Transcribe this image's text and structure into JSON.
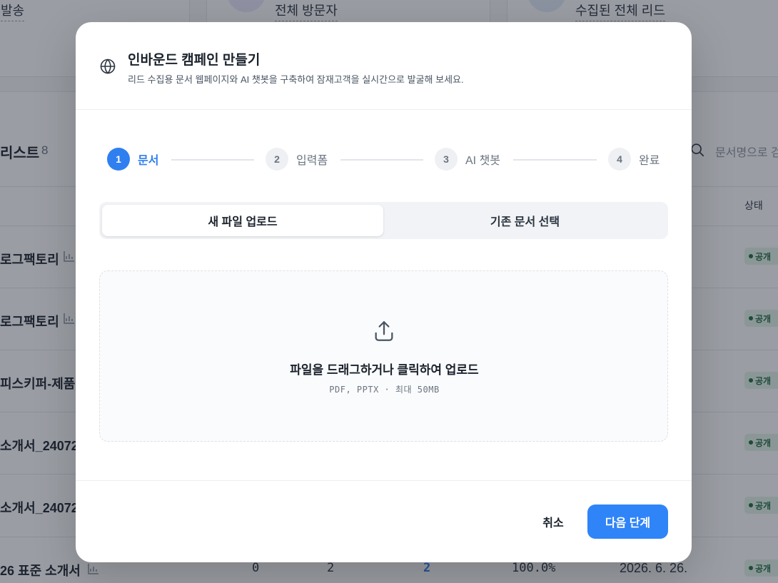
{
  "background": {
    "stats": [
      {
        "label": "발송"
      },
      {
        "label": "전체 방문자"
      },
      {
        "label": "수집된 전체 리드"
      }
    ],
    "list_title": "리스트",
    "list_count": "8",
    "search_placeholder": "문서명으로 검",
    "col_status": "상태",
    "rows": [
      {
        "name": "로그팩토리",
        "status": "공개"
      },
      {
        "name": "로그팩토리",
        "status": "공개"
      },
      {
        "name": "피스키퍼-제품",
        "status": "공개"
      },
      {
        "name": "소개서_24072",
        "status": "공개"
      },
      {
        "name": "소개서_24072",
        "status": "공개"
      },
      {
        "name": "26 표준 소개서",
        "status": "공개",
        "c1": "0",
        "c2": "2",
        "c3": "2",
        "rate": "100.0%",
        "date": "2026. 6. 26."
      }
    ]
  },
  "modal": {
    "title": "인바운드 캠페인 만들기",
    "subtitle": "리드 수집용 문서 웹페이지와 AI 챗봇을 구축하여 잠재고객을 실시간으로 발굴해 보세요.",
    "steps": [
      {
        "num": "1",
        "label": "문서",
        "state": "active"
      },
      {
        "num": "2",
        "label": "입력폼",
        "state": "idle"
      },
      {
        "num": "3",
        "label": "AI 챗봇",
        "state": "idle"
      },
      {
        "num": "4",
        "label": "완료",
        "state": "idle"
      }
    ],
    "tabs": {
      "upload": "새 파일 업로드",
      "existing": "기존 문서 선택"
    },
    "dropzone": {
      "title": "파일을 드래그하거나 클릭하여 업로드",
      "hint": "PDF, PPTX · 최대 50MB"
    },
    "footer": {
      "cancel": "취소",
      "next": "다음 단계"
    }
  },
  "colors": {
    "accent": "#2f7ff0",
    "primary_button": "#2f84f7",
    "badge_bg": "#e4f4ea",
    "badge_text": "#1e6b3d"
  }
}
